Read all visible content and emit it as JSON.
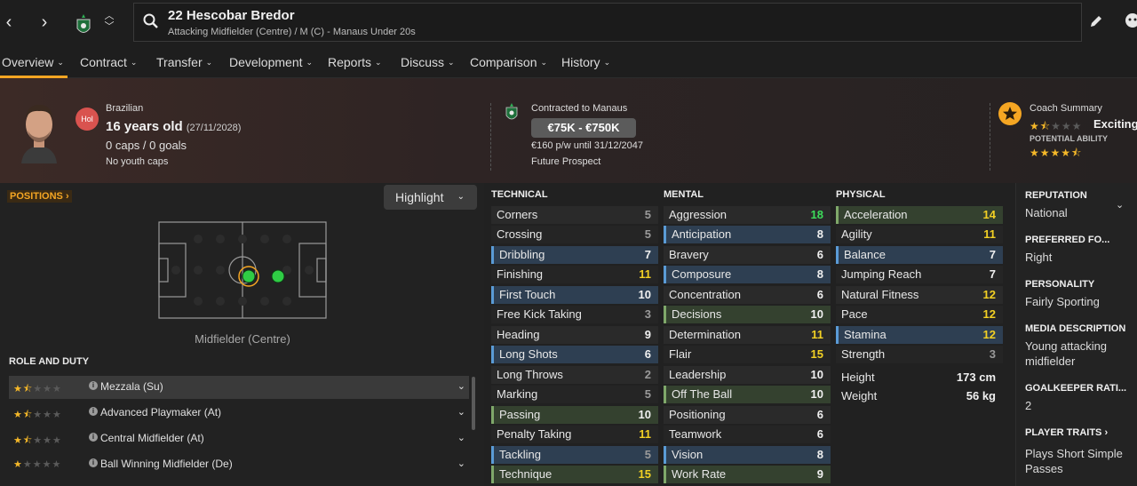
{
  "topbar": {
    "player_title": "22 Hescobar Bredor",
    "player_subtitle": "Attacking Midfielder (Centre) / M (C) - Manaus Under 20s",
    "back_icon": "chevron-left-icon",
    "forward_icon": "chevron-right-icon"
  },
  "tabs": [
    {
      "label": "Overview"
    },
    {
      "label": "Contract"
    },
    {
      "label": "Transfer"
    },
    {
      "label": "Development"
    },
    {
      "label": "Reports"
    },
    {
      "label": "Discuss"
    },
    {
      "label": "Comparison"
    },
    {
      "label": "History"
    }
  ],
  "header": {
    "nationality": "Brazilian",
    "nation_badge": "Hol",
    "age": "16 years old",
    "dob": "(27/11/2028)",
    "caps": "0 caps / 0 goals",
    "youth_caps": "No youth caps",
    "contract_label": "Contracted to Manaus",
    "value_range": "€75K - €750K",
    "wage": "€160 p/w until 31/12/2047",
    "prospect": "Future Prospect",
    "coach_label": "Coach Summary",
    "coach_verdict": "Exciting",
    "pa_label": "POTENTIAL ABILITY",
    "current_ability_stars": 1.5,
    "potential_ability_stars": 4.5
  },
  "positions": {
    "label": "POSITIONS ›",
    "highlight": "Highlight",
    "caption": "Midfielder (Centre)"
  },
  "roles": {
    "title": "ROLE AND DUTY",
    "items": [
      {
        "name": "Mezzala (Su)",
        "stars": 1.5
      },
      {
        "name": "Advanced Playmaker (At)",
        "stars": 1.5
      },
      {
        "name": "Central Midfielder (At)",
        "stars": 1.5
      },
      {
        "name": "Ball Winning Midfielder (De)",
        "stars": 1
      }
    ]
  },
  "technical": {
    "title": "TECHNICAL",
    "rows": [
      {
        "name": "Corners",
        "value": "5"
      },
      {
        "name": "Crossing",
        "value": "5"
      },
      {
        "name": "Dribbling",
        "value": "7"
      },
      {
        "name": "Finishing",
        "value": "11"
      },
      {
        "name": "First Touch",
        "value": "10"
      },
      {
        "name": "Free Kick Taking",
        "value": "3"
      },
      {
        "name": "Heading",
        "value": "9"
      },
      {
        "name": "Long Shots",
        "value": "6"
      },
      {
        "name": "Long Throws",
        "value": "2"
      },
      {
        "name": "Marking",
        "value": "5"
      },
      {
        "name": "Passing",
        "value": "10"
      },
      {
        "name": "Penalty Taking",
        "value": "11"
      },
      {
        "name": "Tackling",
        "value": "5"
      },
      {
        "name": "Technique",
        "value": "15"
      }
    ]
  },
  "mental": {
    "title": "MENTAL",
    "rows": [
      {
        "name": "Aggression",
        "value": "18"
      },
      {
        "name": "Anticipation",
        "value": "8"
      },
      {
        "name": "Bravery",
        "value": "6"
      },
      {
        "name": "Composure",
        "value": "8"
      },
      {
        "name": "Concentration",
        "value": "6"
      },
      {
        "name": "Decisions",
        "value": "10"
      },
      {
        "name": "Determination",
        "value": "11"
      },
      {
        "name": "Flair",
        "value": "15"
      },
      {
        "name": "Leadership",
        "value": "10"
      },
      {
        "name": "Off The Ball",
        "value": "10"
      },
      {
        "name": "Positioning",
        "value": "6"
      },
      {
        "name": "Teamwork",
        "value": "6"
      },
      {
        "name": "Vision",
        "value": "8"
      },
      {
        "name": "Work Rate",
        "value": "9"
      }
    ]
  },
  "physical": {
    "title": "PHYSICAL",
    "rows": [
      {
        "name": "Acceleration",
        "value": "14"
      },
      {
        "name": "Agility",
        "value": "11"
      },
      {
        "name": "Balance",
        "value": "7"
      },
      {
        "name": "Jumping Reach",
        "value": "7"
      },
      {
        "name": "Natural Fitness",
        "value": "12"
      },
      {
        "name": "Pace",
        "value": "12"
      },
      {
        "name": "Stamina",
        "value": "12"
      },
      {
        "name": "Strength",
        "value": "3"
      }
    ],
    "height_label": "Height",
    "height": "173 cm",
    "weight_label": "Weight",
    "weight": "56 kg"
  },
  "info": {
    "reputation_label": "REPUTATION",
    "reputation": "National",
    "foot_label": "PREFERRED FO...",
    "foot": "Right",
    "personality_label": "PERSONALITY",
    "personality": "Fairly Sporting",
    "media_label": "MEDIA DESCRIPTION",
    "media": "Young attacking midfielder",
    "gk_label": "GOALKEEPER RATI...",
    "gk": "2",
    "traits_label": "PLAYER TRAITS ›",
    "traits": "Plays Short Simple Passes"
  },
  "colors": {
    "accent": "#f5a623",
    "value_high": "#3ddc5a",
    "value_good": "#f2d024",
    "value_mid": "#f0f0f0",
    "value_low": "#9a9a9a"
  }
}
